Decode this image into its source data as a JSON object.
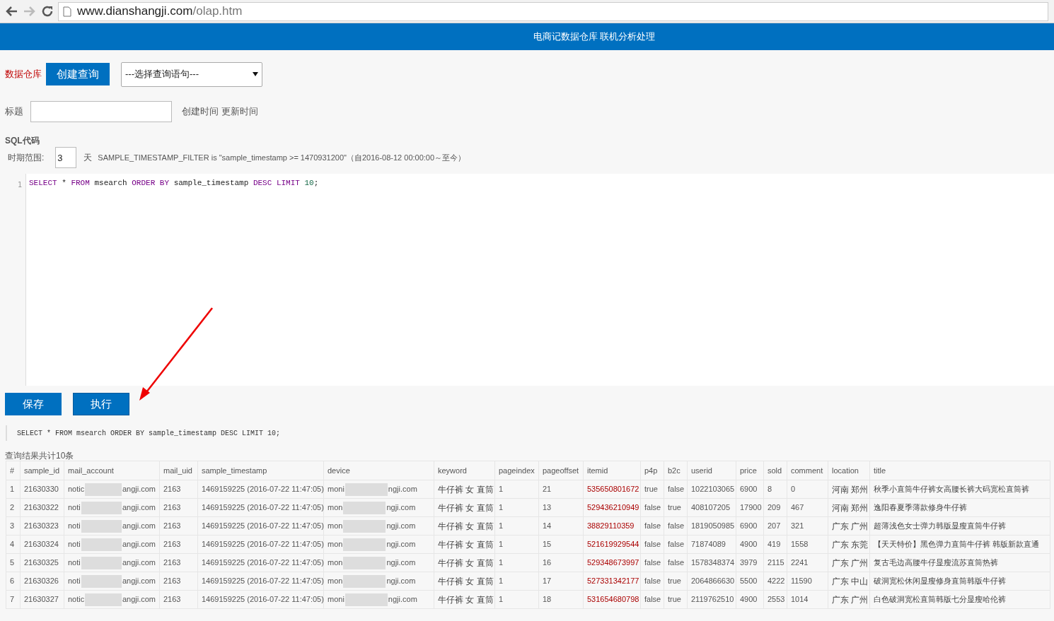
{
  "browser": {
    "url_host": "www.dianshangji.com",
    "url_path": "/olap.htm"
  },
  "header": {
    "title": "电商记数据仓库 联机分析处理"
  },
  "toolbar": {
    "brand": "数据仓库",
    "create_button": "创建查询",
    "query_select": "---选择查询语句---"
  },
  "title_row": {
    "label": "标题",
    "created_label": "创建时间",
    "updated_label": "更新时间"
  },
  "sql_section": {
    "heading": "SQL代码",
    "period_label": "时期范围:",
    "period_value": "3",
    "period_unit": "天",
    "filter_note": "SAMPLE_TIMESTAMP_FILTER is \"sample_timestamp >= 1470931200\"（自2016-08-12 00:00:00～至今）"
  },
  "editor": {
    "lines": [
      {
        "number": "1",
        "tokens": [
          {
            "kind": "keyword",
            "text": "SELECT"
          },
          {
            "kind": "plain",
            "text": " * "
          },
          {
            "kind": "keyword",
            "text": "FROM"
          },
          {
            "kind": "plain",
            "text": " msearch "
          },
          {
            "kind": "keyword",
            "text": "ORDER BY"
          },
          {
            "kind": "plain",
            "text": " sample_timestamp "
          },
          {
            "kind": "keyword",
            "text": "DESC LIMIT "
          },
          {
            "kind": "number",
            "text": "10"
          },
          {
            "kind": "plain",
            "text": ";"
          }
        ]
      }
    ]
  },
  "buttons": [
    "保存",
    "执行"
  ],
  "executed_sql": "SELECT * FROM msearch ORDER BY sample_timestamp DESC LIMIT 10;",
  "result_count": "查询结果共计10条",
  "table": {
    "columns": [
      "#",
      "sample_id",
      "mail_account",
      "mail_uid",
      "sample_timestamp",
      "device",
      "keyword",
      "pageindex",
      "pageoffset",
      "itemid",
      "p4p",
      "b2c",
      "userid",
      "price",
      "sold",
      "comment",
      "location",
      "title"
    ],
    "rows": [
      {
        "cells": [
          "1",
          "21630330",
          {
            "prefix": "notic",
            "suffix": "angji.com"
          },
          "2163",
          "1469159225 (2016-07-22 11:47:05)",
          {
            "prefix": "moni",
            "suffix": "ngji.com"
          },
          "牛仔裤 女 直筒",
          "1",
          "21",
          "535650801672",
          "true",
          "false",
          "1022103065",
          "6900",
          "8",
          "0",
          "河南 郑州",
          "秋季小直筒牛仔裤女高腰长裤大码宽松直筒裤"
        ]
      },
      {
        "cells": [
          "2",
          "21630322",
          {
            "prefix": "noti",
            "suffix": "angji.com"
          },
          "2163",
          "1469159225 (2016-07-22 11:47:05)",
          {
            "prefix": "mon",
            "suffix": "ngji.com"
          },
          "牛仔裤 女 直筒",
          "1",
          "13",
          "529436210949",
          "false",
          "true",
          "408107205",
          "17900",
          "209",
          "467",
          "河南 郑州",
          "逸阳春夏季薄款修身牛仔裤"
        ]
      },
      {
        "cells": [
          "3",
          "21630323",
          {
            "prefix": "noti",
            "suffix": "angji.com"
          },
          "2163",
          "1469159225 (2016-07-22 11:47:05)",
          {
            "prefix": "mon",
            "suffix": "ngji.com"
          },
          "牛仔裤 女 直筒",
          "1",
          "14",
          "38829110359",
          "false",
          "false",
          "1819050985",
          "6900",
          "207",
          "321",
          "广东 广州",
          "超薄浅色女士弹力韩版显瘦直筒牛仔裤"
        ]
      },
      {
        "cells": [
          "4",
          "21630324",
          {
            "prefix": "noti",
            "suffix": "angji.com"
          },
          "2163",
          "1469159225 (2016-07-22 11:47:05)",
          {
            "prefix": "mon",
            "suffix": "ngji.com"
          },
          "牛仔裤 女 直筒",
          "1",
          "15",
          "521619929544",
          "false",
          "false",
          "71874089",
          "4900",
          "419",
          "1558",
          "广东 东莞",
          "【天天特价】黑色弹力直筒牛仔裤 韩版新款直通"
        ]
      },
      {
        "cells": [
          "5",
          "21630325",
          {
            "prefix": "noti",
            "suffix": "angji.com"
          },
          "2163",
          "1469159225 (2016-07-22 11:47:05)",
          {
            "prefix": "mon",
            "suffix": "ngji.com"
          },
          "牛仔裤 女 直筒",
          "1",
          "16",
          "529348673997",
          "false",
          "false",
          "1578348374",
          "3979",
          "2115",
          "2241",
          "广东 广州",
          "复古毛边高腰牛仔显瘦流苏直筒热裤"
        ]
      },
      {
        "cells": [
          "6",
          "21630326",
          {
            "prefix": "noti",
            "suffix": "angji.com"
          },
          "2163",
          "1469159225 (2016-07-22 11:47:05)",
          {
            "prefix": "mon",
            "suffix": "ngji.com"
          },
          "牛仔裤 女 直筒",
          "1",
          "17",
          "527331342177",
          "false",
          "true",
          "2064866630",
          "5500",
          "4222",
          "11590",
          "广东 中山",
          "破洞宽松休闲显瘦修身直筒韩版牛仔裤"
        ]
      },
      {
        "cells": [
          "7",
          "21630327",
          {
            "prefix": "notic",
            "suffix": "angji.com"
          },
          "2163",
          "1469159225 (2016-07-22 11:47:05)",
          {
            "prefix": "moni",
            "suffix": "ngji.com"
          },
          "牛仔裤 女 直筒",
          "1",
          "18",
          "531654680798",
          "false",
          "true",
          "2119762510",
          "4900",
          "2553",
          "1014",
          "广东 广州",
          "白色破洞宽松直筒韩版七分显瘦哈伦裤"
        ]
      }
    ]
  }
}
